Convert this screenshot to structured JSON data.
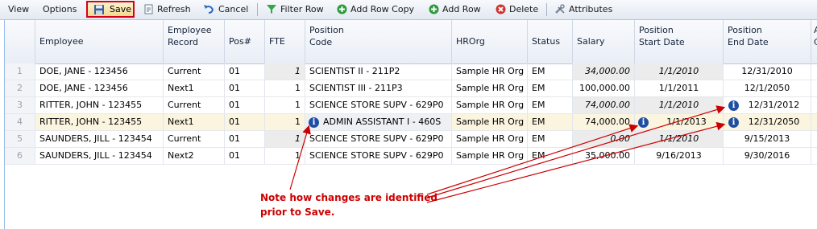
{
  "toolbar": {
    "view": "View",
    "options": "Options",
    "save": "Save",
    "refresh": "Refresh",
    "cancel": "Cancel",
    "filter_row": "Filter Row",
    "add_row_copy": "Add Row Copy",
    "add_row": "Add Row",
    "delete": "Delete",
    "attributes": "Attributes"
  },
  "columns": {
    "employee": "Employee",
    "employee_record": "Employee\nRecord",
    "pos": "Pos#",
    "fte": "FTE",
    "position_code": "Position\nCode",
    "hrorg": "HROrg",
    "status": "Status",
    "salary": "Salary",
    "start_date": "Position\nStart Date",
    "end_date": "Position\nEnd Date",
    "extra": "A\nC"
  },
  "rows": [
    {
      "n": "1",
      "employee": "DOE, JANE - 123456",
      "record": "Current",
      "pos": "01",
      "fte": "1",
      "code": "SCIENTIST II - 211P2",
      "hrorg": "Sample HR Org",
      "status": "EM",
      "salary": "34,000.00",
      "start": "1/1/2010",
      "end": "12/31/2010"
    },
    {
      "n": "2",
      "employee": "DOE, JANE - 123456",
      "record": "Next1",
      "pos": "01",
      "fte": "1",
      "code": "SCIENTIST III - 211P3",
      "hrorg": "Sample HR Org",
      "status": "EM",
      "salary": "100,000.00",
      "start": "1/1/2011",
      "end": "12/1/2050"
    },
    {
      "n": "3",
      "employee": "RITTER, JOHN - 123455",
      "record": "Current",
      "pos": "01",
      "fte": "1",
      "code": "SCIENCE STORE SUPV - 629P0",
      "hrorg": "Sample HR Org",
      "status": "EM",
      "salary": "74,000.00",
      "start": "1/1/2010",
      "end": "12/31/2012"
    },
    {
      "n": "4",
      "employee": "RITTER, JOHN - 123455",
      "record": "Next1",
      "pos": "01",
      "fte": "1",
      "code": "ADMIN ASSISTANT I - 460S",
      "hrorg": "Sample HR Org",
      "status": "EM",
      "salary": "74,000.00",
      "start": "1/1/2013",
      "end": "12/31/2050"
    },
    {
      "n": "5",
      "employee": "SAUNDERS, JILL - 123454",
      "record": "Current",
      "pos": "01",
      "fte": "1",
      "code": "SCIENCE STORE SUPV - 629P0",
      "hrorg": "Sample HR Org",
      "status": "EM",
      "salary": "0.00",
      "start": "1/1/2010",
      "end": "9/15/2013"
    },
    {
      "n": "6",
      "employee": "SAUNDERS, JILL - 123454",
      "record": "Next2",
      "pos": "01",
      "fte": "1",
      "code": "SCIENCE STORE SUPV - 629P0",
      "hrorg": "Sample HR Org",
      "status": "EM",
      "salary": "35,000.00",
      "start": "9/16/2013",
      "end": "9/30/2016"
    }
  ],
  "annotation": "Note how changes are identified\nprior to Save.",
  "colors": {
    "annotation": "#cc0000",
    "save_border": "#d6001c",
    "info_icon": "#1f4fa3"
  }
}
